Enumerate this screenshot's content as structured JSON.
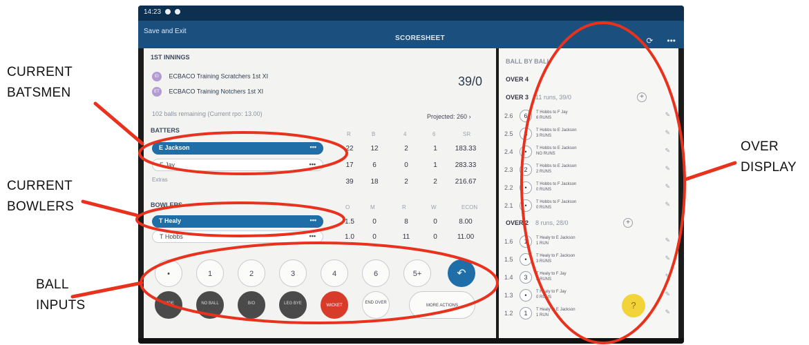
{
  "annotations": {
    "batsmen": [
      "CURRENT",
      "BATSMEN"
    ],
    "bowlers": [
      "CURRENT",
      "BOWLERS"
    ],
    "inputs": [
      "BALL",
      "INPUTS"
    ],
    "over": [
      "OVER",
      "DISPLAY"
    ]
  },
  "status": {
    "time": "14:23"
  },
  "appbar": {
    "save_exit": "Save and Exit",
    "title": "SCORESHEET",
    "more": "•••"
  },
  "innings": {
    "label": "1ST INNINGS",
    "team1": {
      "badge": "EI",
      "name": "ECBACO Training Scratchers 1st XI"
    },
    "team2": {
      "badge": "ET",
      "name": "ECBACO Training Notchers 1st XI"
    },
    "score": "39/0",
    "balls_remaining": "102 balls remaining (Current rpo: 13.00)",
    "projected": "Projected: 260"
  },
  "batters": {
    "label": "BATTERS",
    "headers": [
      "R",
      "B",
      "4",
      "6",
      "SR"
    ],
    "rows": [
      {
        "name": "E Jackson",
        "cells": [
          "22",
          "12",
          "2",
          "1",
          "183.33"
        ],
        "active": true
      },
      {
        "name": "F Jay",
        "cells": [
          "17",
          "6",
          "0",
          "1",
          "283.33"
        ],
        "active": false
      }
    ],
    "total_label": "Extras",
    "total_cells": [
      "39",
      "18",
      "2",
      "2",
      "216.67"
    ]
  },
  "bowlers": {
    "label": "BOWLERS",
    "headers": [
      "O",
      "M",
      "R",
      "W",
      "ECON"
    ],
    "rows": [
      {
        "name": "T Healy",
        "cells": [
          "1.5",
          "0",
          "8",
          "0",
          "8.00"
        ],
        "active": true
      },
      {
        "name": "T Hobbs",
        "cells": [
          "1.0",
          "0",
          "11",
          "0",
          "11.00"
        ],
        "active": false
      }
    ]
  },
  "ball_inputs": {
    "row1": [
      "•",
      "1",
      "2",
      "3",
      "4",
      "6",
      "5+"
    ],
    "undo": "↶",
    "row2": [
      "WIDE",
      "NO BALL",
      "B/O",
      "LEG BYE",
      "WICKET",
      "END OVER"
    ],
    "more_actions": "MORE ACTIONS"
  },
  "over_display": {
    "header": "BALL BY BALL",
    "current_over": "OVER 4",
    "overs": [
      {
        "label": "OVER 3",
        "summary": "11 runs, 39/0",
        "balls": [
          {
            "num": "2.6",
            "val": "6",
            "desc": [
              "T Hobbs to F Jay",
              "6 RUNS"
            ]
          },
          {
            "num": "2.5",
            "val": "3",
            "desc": [
              "T Hobbs to E Jackson",
              "3 RUNS"
            ]
          },
          {
            "num": "2.4",
            "val": "•",
            "desc": [
              "T Hobbs to E Jackson",
              "NO RUNS"
            ]
          },
          {
            "num": "2.3",
            "val": "2",
            "desc": [
              "T Hobbs to E Jackson",
              "2 RUNS"
            ]
          },
          {
            "num": "2.2",
            "val": "•",
            "desc": [
              "T Hobbs to F Jackson",
              "0 RUNS"
            ]
          },
          {
            "num": "2.1",
            "val": "•",
            "desc": [
              "T Hobbs to F Jackson",
              "0 RUNS"
            ]
          }
        ]
      },
      {
        "label": "OVER 2",
        "summary": "8 runs, 28/0",
        "balls": [
          {
            "num": "1.6",
            "val": "1",
            "desc": [
              "T Healy to E Jackson",
              "1 RUN"
            ]
          },
          {
            "num": "1.5",
            "val": "•",
            "desc": [
              "T Healy to F Jackson",
              "3 RUNS"
            ]
          },
          {
            "num": "1.4",
            "val": "3",
            "desc": [
              "T Healy to F Jay",
              "3 RUNS"
            ]
          },
          {
            "num": "1.3",
            "val": "•",
            "desc": [
              "T Healy to F Jay",
              "0 RUNS"
            ]
          },
          {
            "num": "1.2",
            "val": "1",
            "desc": [
              "T Healy to E Jackson",
              "1 RUN"
            ]
          }
        ]
      }
    ],
    "help": "?"
  },
  "colors": {
    "annotation_red": "#e8321e",
    "primary_blue": "#1f6ea8",
    "wicket_red": "#d93b2b"
  }
}
